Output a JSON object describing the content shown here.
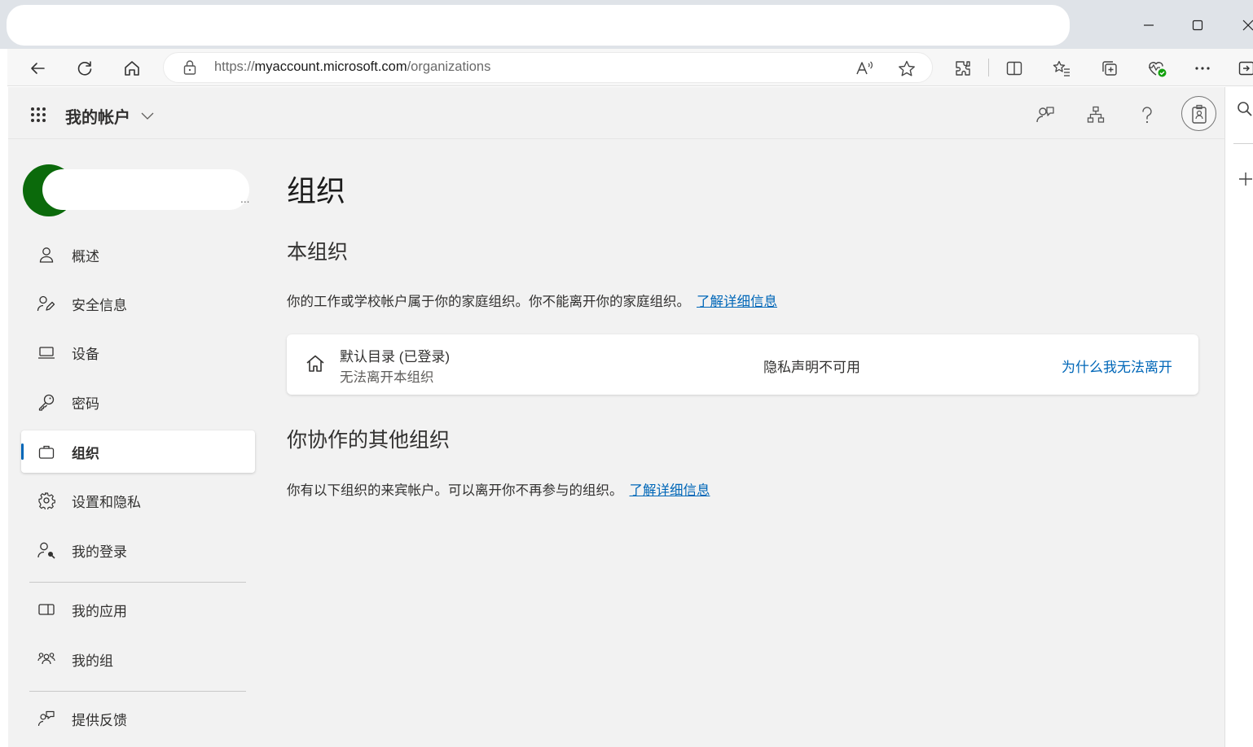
{
  "browser": {
    "url_scheme": "https://",
    "url_host": "myaccount.microsoft.com",
    "url_path": "/organizations"
  },
  "app": {
    "title": "我的帐户"
  },
  "nav": [
    {
      "label": "概述",
      "icon": "person-icon"
    },
    {
      "label": "安全信息",
      "icon": "security-info-icon"
    },
    {
      "label": "设备",
      "icon": "laptop-icon"
    },
    {
      "label": "密码",
      "icon": "key-icon"
    },
    {
      "label": "组织",
      "icon": "briefcase-icon",
      "active": true
    },
    {
      "label": "设置和隐私",
      "icon": "gear-icon"
    },
    {
      "label": "我的登录",
      "icon": "sign-ins-icon"
    },
    {
      "label": "我的应用",
      "icon": "apps-icon"
    },
    {
      "label": "我的组",
      "icon": "groups-icon"
    },
    {
      "label": "提供反馈",
      "icon": "feedback-icon"
    }
  ],
  "main": {
    "title": "组织",
    "home_org": {
      "heading": "本组织",
      "description": "你的工作或学校帐户属于你的家庭组织。你不能离开你的家庭组织。",
      "learn_more": "了解详细信息",
      "card": {
        "name": "默认目录 (已登录)",
        "status": "无法离开本组织",
        "privacy": "隐私声明不可用",
        "why_link": "为什么我无法离开"
      }
    },
    "other_orgs": {
      "heading": "你协作的其他组织",
      "description": "你有以下组织的来宾帐户。可以离开你不再参与的组织。",
      "learn_more": "了解详细信息"
    }
  },
  "profile": {
    "more": "..."
  },
  "colors": {
    "accent": "#0067b8",
    "avatar": "#0b6a0b"
  }
}
